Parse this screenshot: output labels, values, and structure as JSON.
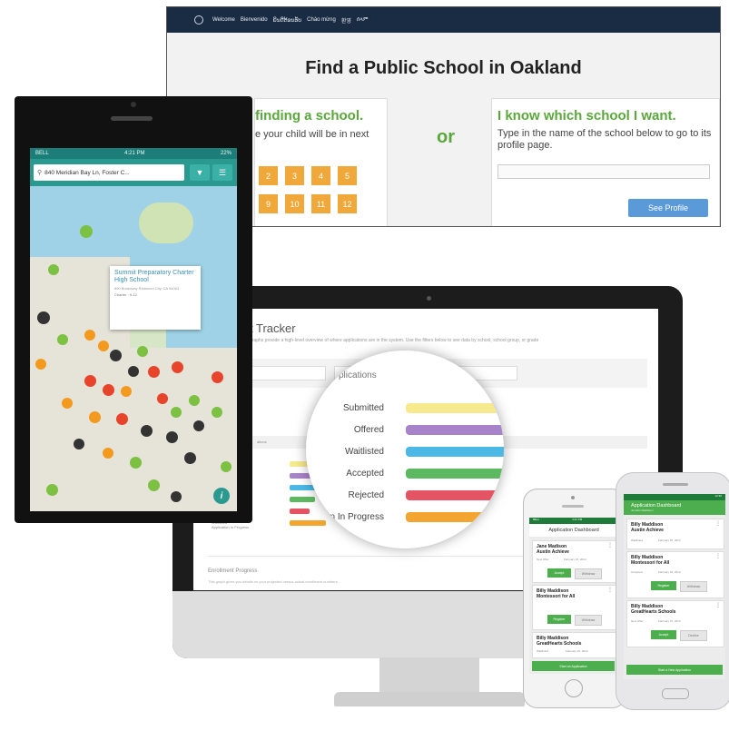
{
  "website": {
    "languages": [
      "Welcome",
      "Bienvenido",
      "ຍິນດີຕ້ອນຮັບ",
      "Chào mừng",
      "환영",
      "ሰላም"
    ],
    "title": "Find a Public School in Oakland",
    "left_card": {
      "heading": "finding a school.",
      "text": "e your child will be in next",
      "grades_row1": [
        "2",
        "3",
        "4",
        "5"
      ],
      "grades_row2": [
        "9",
        "10",
        "11",
        "12"
      ]
    },
    "or": "or",
    "right_card": {
      "heading": "I know which school I want.",
      "text": "Type in the name of the school below to go to its profile page.",
      "search_value": "",
      "button": "See Profile"
    }
  },
  "map_phone": {
    "status_carrier": "BELL",
    "status_time": "4:21 PM",
    "status_battery": "22%",
    "search_value": "840 Meridian Bay Ln, Foster C...",
    "popup": {
      "title": "Summit Preparatory Charter High School",
      "address": "890 Broadway Redwood City, CA 94063",
      "grades": "Charter · 9-12"
    },
    "info_button": "i"
  },
  "imac": {
    "title": "t Tracker",
    "subtitle": "graphs provide a high-level overview of where applications are in the system. Use the filters below to see data by school, school group, or grade",
    "lens_title": "plications",
    "statuses": [
      {
        "label": "Submitted",
        "color": "#f7e98e"
      },
      {
        "label": "Offered",
        "color": "#a983c9"
      },
      {
        "label": "Waitlisted",
        "color": "#4bb8e6"
      },
      {
        "label": "Accepted",
        "color": "#5db961"
      },
      {
        "label": "Rejected",
        "color": "#e45464"
      },
      {
        "label": "on In Progress",
        "color": "#f3a431"
      }
    ],
    "small_labels": [
      "Submitted",
      "Offered",
      "Waitlisted",
      "Accepted",
      "Rejected",
      "Waitlisted",
      "Application In Progress"
    ],
    "section_label": "ations",
    "footer_title": "Enrollment Progress",
    "footer_sub": "This graph gives you details on your projected versus actual enrollment numbers."
  },
  "iphone_app": {
    "status_carrier": "BELL",
    "status_time": "4:21 PM",
    "header": "Application Dashboard",
    "cards": [
      {
        "name": "Jane Madison",
        "school": "Austin Achieve",
        "status": "New Offer",
        "date": "February 15, 2014",
        "primary": "Accept",
        "secondary": "Withdraw"
      },
      {
        "name": "Billy Maddison",
        "school": "Montessori for All",
        "status": "",
        "date": "",
        "primary": "Register",
        "secondary": "Withdraw"
      },
      {
        "name": "Billy Maddison",
        "school": "GreatHearts Schools",
        "status": "Waitlisted",
        "date": "February 15, 2014",
        "primary": "",
        "secondary": ""
      }
    ],
    "cta": "Start an Application"
  },
  "android_app": {
    "status_time": "12:30",
    "header": "Application Dashboard",
    "header_sub": "Jennifer Maddison",
    "cards": [
      {
        "name": "Billy Maddison",
        "school": "Austin Achieve",
        "status": "Waitlisted",
        "date": "February 15, 2014",
        "primary": "",
        "secondary": ""
      },
      {
        "name": "Billy Maddison",
        "school": "Montessori for All",
        "status": "Accepted",
        "date": "February 15, 2014",
        "primary": "Register",
        "secondary": "Withdraw"
      },
      {
        "name": "Billy Maddison",
        "school": "GreatHearts Schools",
        "status": "New Offer",
        "date": "February 15, 2014",
        "primary": "Accept",
        "secondary": "Decline"
      }
    ],
    "cta": "Start a New Application"
  },
  "colors": {
    "oakland_navy": "#1a2c44",
    "green": "#5aa83c",
    "grade_orange": "#f0a83a",
    "teal": "#2a9a91",
    "app_green": "#4cae4c"
  }
}
